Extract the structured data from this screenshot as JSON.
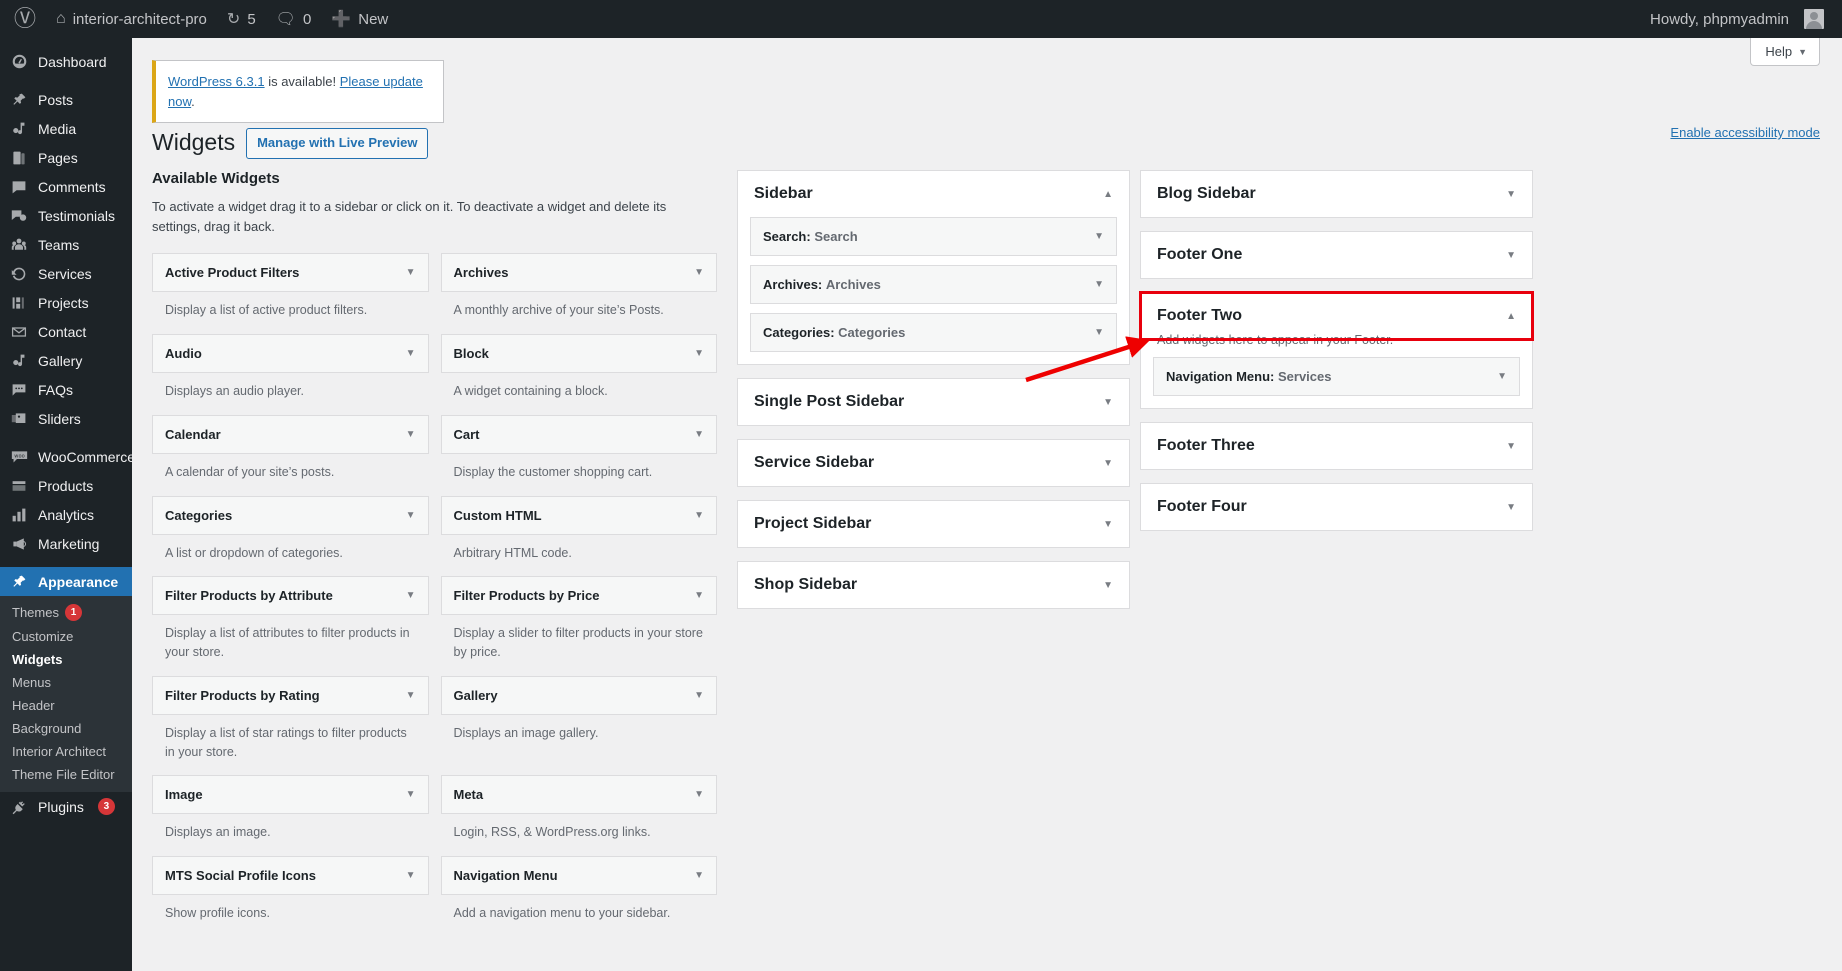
{
  "adminbar": {
    "logo_icon": "wordpress-logo-icon",
    "site_name": "interior-architect-pro",
    "site_icon": "home-icon",
    "updates_icon": "updates-icon",
    "updates_count": "5",
    "comments_icon": "comment-bubble-icon",
    "comments_count": "0",
    "new_icon": "plus-icon",
    "new_label": "New",
    "howdy": "Howdy, phpmyadmin",
    "avatar": "user-avatar"
  },
  "sidebar": {
    "items": [
      {
        "label": "Dashboard",
        "icon": "dashboard-icon",
        "current": false,
        "sep_before": false
      },
      {
        "label": "Posts",
        "icon": "pin-icon",
        "current": false,
        "sep_before": true
      },
      {
        "label": "Media",
        "icon": "media-icon",
        "current": false,
        "sep_before": false
      },
      {
        "label": "Pages",
        "icon": "pages-icon",
        "current": false,
        "sep_before": false
      },
      {
        "label": "Comments",
        "icon": "comment-bubble-icon",
        "current": false,
        "sep_before": false
      },
      {
        "label": "Testimonials",
        "icon": "testimonials-icon",
        "current": false,
        "sep_before": false
      },
      {
        "label": "Teams",
        "icon": "groups-icon",
        "current": false,
        "sep_before": false
      },
      {
        "label": "Services",
        "icon": "update-icon",
        "current": false,
        "sep_before": false
      },
      {
        "label": "Projects",
        "icon": "projects-icon",
        "current": false,
        "sep_before": false
      },
      {
        "label": "Contact",
        "icon": "envelope-icon",
        "current": false,
        "sep_before": false
      },
      {
        "label": "Gallery",
        "icon": "media-icon",
        "current": false,
        "sep_before": false
      },
      {
        "label": "FAQs",
        "icon": "faq-bubble-icon",
        "current": false,
        "sep_before": false
      },
      {
        "label": "Sliders",
        "icon": "sliders-icon",
        "current": false,
        "sep_before": false
      },
      {
        "label": "WooCommerce",
        "icon": "woocommerce-icon",
        "current": false,
        "sep_before": true
      },
      {
        "label": "Products",
        "icon": "products-icon",
        "current": false,
        "sep_before": false
      },
      {
        "label": "Analytics",
        "icon": "bar-chart-icon",
        "current": false,
        "sep_before": false
      },
      {
        "label": "Marketing",
        "icon": "megaphone-icon",
        "current": false,
        "sep_before": false
      },
      {
        "label": "Appearance",
        "icon": "brush-icon",
        "current": true,
        "sep_before": true
      }
    ],
    "appearance_submenu": [
      {
        "label": "Themes",
        "badge": "1",
        "current": false
      },
      {
        "label": "Customize",
        "badge": "",
        "current": false
      },
      {
        "label": "Widgets",
        "badge": "",
        "current": true
      },
      {
        "label": "Menus",
        "badge": "",
        "current": false
      },
      {
        "label": "Header",
        "badge": "",
        "current": false
      },
      {
        "label": "Background",
        "badge": "",
        "current": false
      },
      {
        "label": "Interior Architect",
        "badge": "",
        "current": false
      },
      {
        "label": "Theme File Editor",
        "badge": "",
        "current": false
      }
    ],
    "plugins": {
      "label": "Plugins",
      "icon": "plug-icon",
      "badge": "3"
    }
  },
  "header": {
    "help_label": "Help",
    "notice": {
      "link1": "WordPress 6.3.1",
      "mid": " is available! ",
      "link2": "Please update now",
      "end": "."
    },
    "page_title": "Widgets",
    "live_preview_button": "Manage with Live Preview",
    "accessibility_link": "Enable accessibility mode"
  },
  "available": {
    "title": "Available Widgets",
    "description": "To activate a widget drag it to a sidebar or click on it. To deactivate a widget and delete its settings, drag it back.",
    "widgets": [
      {
        "name": "Active Product Filters",
        "desc": "Display a list of active product filters."
      },
      {
        "name": "Archives",
        "desc": "A monthly archive of your site’s Posts."
      },
      {
        "name": "Audio",
        "desc": "Displays an audio player."
      },
      {
        "name": "Block",
        "desc": "A widget containing a block."
      },
      {
        "name": "Calendar",
        "desc": "A calendar of your site’s posts."
      },
      {
        "name": "Cart",
        "desc": "Display the customer shopping cart."
      },
      {
        "name": "Categories",
        "desc": "A list or dropdown of categories."
      },
      {
        "name": "Custom HTML",
        "desc": "Arbitrary HTML code."
      },
      {
        "name": "Filter Products by Attribute",
        "desc": "Display a list of attributes to filter products in your store."
      },
      {
        "name": "Filter Products by Price",
        "desc": "Display a slider to filter products in your store by price."
      },
      {
        "name": "Filter Products by Rating",
        "desc": "Display a list of star ratings to filter products in your store."
      },
      {
        "name": "Gallery",
        "desc": "Displays an image gallery."
      },
      {
        "name": "Image",
        "desc": "Displays an image."
      },
      {
        "name": "Meta",
        "desc": "Login, RSS, & WordPress.org links."
      },
      {
        "name": "MTS Social Profile Icons",
        "desc": "Show profile icons."
      },
      {
        "name": "Navigation Menu",
        "desc": "Add a navigation menu to your sidebar."
      }
    ]
  },
  "sidebars_col1": [
    {
      "title": "Sidebar",
      "open": true,
      "desc": "",
      "widgets": [
        {
          "name": "Search",
          "value": "Search"
        },
        {
          "name": "Archives",
          "value": "Archives"
        },
        {
          "name": "Categories",
          "value": "Categories"
        }
      ]
    },
    {
      "title": "Single Post Sidebar",
      "open": false,
      "desc": "",
      "widgets": []
    },
    {
      "title": "Service Sidebar",
      "open": false,
      "desc": "",
      "widgets": []
    },
    {
      "title": "Project Sidebar",
      "open": false,
      "desc": "",
      "widgets": []
    },
    {
      "title": "Shop Sidebar",
      "open": false,
      "desc": "",
      "widgets": []
    }
  ],
  "sidebars_col2": [
    {
      "title": "Blog Sidebar",
      "open": false,
      "desc": "",
      "widgets": [],
      "highlighted": false
    },
    {
      "title": "Footer One",
      "open": false,
      "desc": "",
      "widgets": [],
      "highlighted": false
    },
    {
      "title": "Footer Two",
      "open": true,
      "desc": "Add widgets here to appear in your Footer.",
      "widgets": [
        {
          "name": "Navigation Menu",
          "value": "Services"
        }
      ],
      "highlighted": true
    },
    {
      "title": "Footer Three",
      "open": false,
      "desc": "",
      "widgets": [],
      "highlighted": false
    },
    {
      "title": "Footer Four",
      "open": false,
      "desc": "",
      "widgets": [],
      "highlighted": false
    }
  ],
  "annotation": {
    "arrow_color": "#ee0000",
    "highlight_color": "#e8000d"
  },
  "icons": {
    "caret_down": "▼",
    "caret_up": "▲"
  }
}
